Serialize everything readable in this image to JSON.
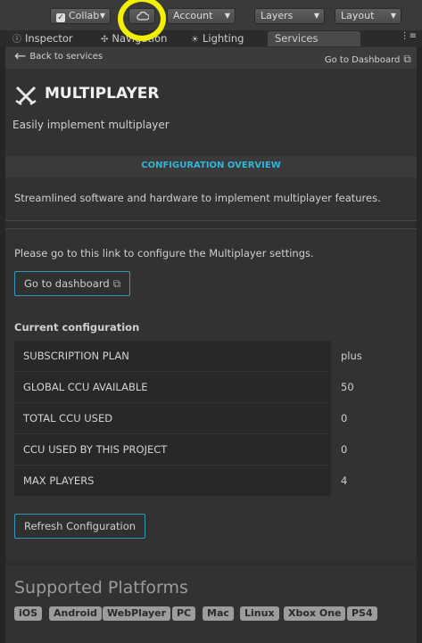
{
  "toolbar": {
    "collab_label": "Collab",
    "account_label": "Account",
    "layers_label": "Layers",
    "layout_label": "Layout",
    "cloud_icon": "cloud-icon"
  },
  "tabs": [
    {
      "label": "Inspector",
      "icon": "info-icon"
    },
    {
      "label": "Navigation",
      "icon": "navigation-icon"
    },
    {
      "label": "Lighting",
      "icon": "lighting-icon"
    },
    {
      "label": "Services",
      "icon": ""
    }
  ],
  "header": {
    "back_label": "Back to services",
    "go_dashboard_label": "Go to Dashboard"
  },
  "service": {
    "title": "MULTIPLAYER",
    "subtitle": "Easily implement multiplayer",
    "section_label": "CONFIGURATION OVERVIEW",
    "description": "Streamlined software and hardware to implement multiplayer features.",
    "info_text": "Please go to this link to configure the Multiplayer settings.",
    "dashboard_button": "Go to dashboard",
    "current_config_label": "Current configuration",
    "refresh_button": "Refresh Configuration"
  },
  "config": [
    {
      "key": "SUBSCRIPTION PLAN",
      "value": "plus"
    },
    {
      "key": "GLOBAL CCU AVAILABLE",
      "value": "50"
    },
    {
      "key": "TOTAL CCU USED",
      "value": "0"
    },
    {
      "key": "CCU USED BY THIS PROJECT",
      "value": "0"
    },
    {
      "key": "MAX PLAYERS",
      "value": "4"
    }
  ],
  "platforms": {
    "title": "Supported Platforms",
    "items": [
      "iOS",
      "Android",
      "WebPlayer",
      "PC",
      "Mac",
      "Linux",
      "Xbox One",
      "PS4"
    ]
  },
  "colors": {
    "accent": "#33b5d8",
    "highlight": "#f3f000",
    "background": "#2e2e2e"
  }
}
